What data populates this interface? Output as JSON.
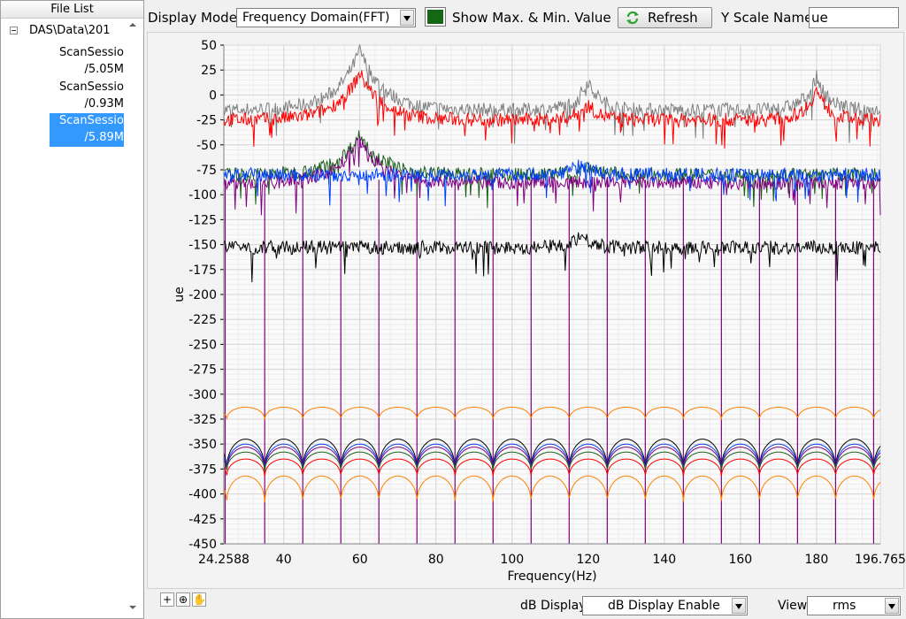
{
  "file_list": {
    "header": "File List",
    "root": "DAS\\Data\\201",
    "items": [
      {
        "name": "ScanSessio",
        "size": "/5.05M",
        "selected": false
      },
      {
        "name": "ScanSessio",
        "size": "/0.93M",
        "selected": false
      },
      {
        "name": "ScanSessio",
        "size": "/5.89M",
        "selected": true
      }
    ]
  },
  "toolbar": {
    "display_mode_label": "Display Mode",
    "display_mode_value": "Frequency Domain(FFT)",
    "maxmin_color": "#146814",
    "maxmin_label": "Show Max. & Min. Value",
    "refresh_label": "Refresh",
    "refresh_icon": "refresh-icon",
    "y_scale_label": "Y Scale Name",
    "y_scale_value": "ue"
  },
  "bottom": {
    "tool_icons": [
      "crosshair-icon",
      "zoom-icon",
      "pan-hand-icon"
    ],
    "db_display_label": "dB Display",
    "db_display_value": "dB Display Enable",
    "view_label": "View",
    "view_value": "rms"
  },
  "chart_data": {
    "type": "line",
    "xlabel": "Frequency(Hz)",
    "ylabel": "ue",
    "xlim": [
      24.2588,
      196.765
    ],
    "ylim": [
      -450,
      50
    ],
    "x_ticks": [
      "24.2588",
      "40",
      "60",
      "80",
      "100",
      "120",
      "140",
      "160",
      "180",
      "196.765"
    ],
    "y_ticks": [
      "50",
      "25",
      "0",
      "-25",
      "-50",
      "-75",
      "-100",
      "-125",
      "-150",
      "-175",
      "-200",
      "-225",
      "-250",
      "-275",
      "-300",
      "-325",
      "-350",
      "-375",
      "-400",
      "-425",
      "-450"
    ],
    "grid": true,
    "series": [
      {
        "color": "#808080",
        "baseline": -15,
        "peaks": [
          {
            "x": 60,
            "y": 45
          },
          {
            "x": 120,
            "y": 15
          },
          {
            "x": 180,
            "y": 18
          }
        ]
      },
      {
        "color": "#ff0000",
        "baseline": -25,
        "peaks": [
          {
            "x": 60,
            "y": 22
          },
          {
            "x": 120,
            "y": -10
          },
          {
            "x": 180,
            "y": 5
          }
        ]
      },
      {
        "color": "#1a5e1a",
        "baseline": -80,
        "peaks": [
          {
            "x": 60,
            "y": -40
          },
          {
            "x": 120,
            "y": -70
          }
        ]
      },
      {
        "color": "#800080",
        "baseline": -88,
        "peaks": [
          {
            "x": 60,
            "y": -45
          }
        ]
      },
      {
        "color": "#0040ff",
        "baseline": -80,
        "peaks": [
          {
            "x": 118,
            "y": -68
          }
        ]
      },
      {
        "color": "#000000",
        "baseline": -153,
        "peaks": [
          {
            "x": 118,
            "y": -140
          }
        ]
      },
      {
        "color": "#ff8000",
        "name_hint": "",
        "baseline": -320,
        "peaks": []
      }
    ]
  }
}
